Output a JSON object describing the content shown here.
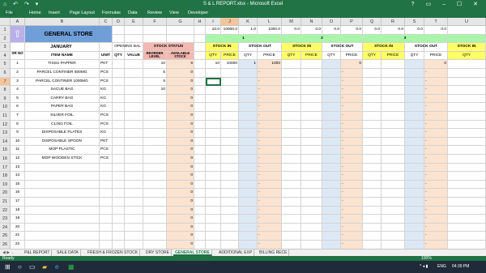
{
  "window": {
    "title": "S & L REPORT.xlsx - Microsoft Excel",
    "quick_access": "⌂ ↶ ↷ ▾",
    "controls": "? ▭ – ☐ ✕"
  },
  "ribbon_tabs": [
    "File",
    "Home",
    "Insert",
    "Page Layout",
    "Formulas",
    "Data",
    "Review",
    "View",
    "Developer"
  ],
  "columns": [
    "A",
    "B",
    "C",
    "D",
    "E",
    "F",
    "G",
    "H",
    "I",
    "J",
    "K",
    "L",
    "M",
    "N",
    "O",
    "P",
    "Q",
    "R",
    "S",
    "T",
    "U"
  ],
  "row_numbers": [
    "1",
    "2",
    "3",
    "4",
    "5",
    "6",
    "7",
    "8",
    "9",
    "10",
    "11",
    "12",
    "13",
    "14",
    "15",
    "16",
    "17",
    "18",
    "19",
    "20",
    "21",
    "22",
    "23",
    "24",
    "25",
    "26"
  ],
  "header": {
    "store_name": "GENERAL STORE",
    "month": "JANUARY",
    "opening_bal": "OPENING BAL",
    "stock_status": "STOCK STATUS",
    "sr_no": "SR NO",
    "item_name": "ITEM NAME",
    "unit": "UNIT",
    "qty": "QTY",
    "value": "VALUE",
    "reorder_level": "REORDER LEVEL",
    "available_stock": "AVAILABLE STOCK",
    "stock_in": "STOCK IN",
    "stock_out": "STOCK OUT",
    "qty_short": "QTY",
    "price": "PRICE"
  },
  "top_values": [
    "10.0",
    "10000.0",
    "1.0",
    "1000.0",
    "0.0",
    "0.0",
    "0.0",
    "0.0",
    "0.0",
    "0.0",
    "0.0",
    "0.0"
  ],
  "days": [
    "1",
    "2",
    "3"
  ],
  "items": [
    {
      "sr": "1",
      "name": "TISSU PAPPER",
      "unit": "PKT",
      "reorder": "10",
      "avail": "9"
    },
    {
      "sr": "2",
      "name": "PARCEL CONTINER 500MG",
      "unit": "PCS",
      "reorder": "5",
      "avail": "0"
    },
    {
      "sr": "3",
      "name": "PARCEL CONTINER 1000MG",
      "unit": "PCS",
      "reorder": "5",
      "avail": "0"
    },
    {
      "sr": "4",
      "name": "SACUE BAG",
      "unit": "KG",
      "reorder": "10",
      "avail": "0"
    },
    {
      "sr": "5",
      "name": "CARRY BAG",
      "unit": "KG",
      "reorder": "",
      "avail": "0"
    },
    {
      "sr": "6",
      "name": "PAPER BAG",
      "unit": "KG",
      "reorder": "",
      "avail": "0"
    },
    {
      "sr": "7",
      "name": "SILVER FOIL",
      "unit": "PCS",
      "reorder": "",
      "avail": "0"
    },
    {
      "sr": "8",
      "name": "CLING FOIL",
      "unit": "PCS",
      "reorder": "",
      "avail": "0"
    },
    {
      "sr": "9",
      "name": "DISPOSABLE PLATES",
      "unit": "KG",
      "reorder": "",
      "avail": "0"
    },
    {
      "sr": "10",
      "name": "DISPOSABLE SPOON",
      "unit": "PKT",
      "reorder": "",
      "avail": "0"
    },
    {
      "sr": "11",
      "name": "MOP PLASTIC",
      "unit": "PCS",
      "reorder": "",
      "avail": "0"
    },
    {
      "sr": "12",
      "name": "MOP WOODEN STICK",
      "unit": "PCS",
      "reorder": "",
      "avail": "0"
    },
    {
      "sr": "13",
      "name": "",
      "unit": "",
      "reorder": "",
      "avail": "0"
    },
    {
      "sr": "14",
      "name": "",
      "unit": "",
      "reorder": "",
      "avail": "0"
    },
    {
      "sr": "15",
      "name": "",
      "unit": "",
      "reorder": "",
      "avail": "0"
    },
    {
      "sr": "16",
      "name": "",
      "unit": "",
      "reorder": "",
      "avail": "0"
    },
    {
      "sr": "17",
      "name": "",
      "unit": "",
      "reorder": "",
      "avail": "0"
    },
    {
      "sr": "18",
      "name": "",
      "unit": "",
      "reorder": "",
      "avail": "0"
    },
    {
      "sr": "19",
      "name": "",
      "unit": "",
      "reorder": "",
      "avail": "0"
    },
    {
      "sr": "20",
      "name": "",
      "unit": "",
      "reorder": "",
      "avail": "0"
    },
    {
      "sr": "21",
      "name": "",
      "unit": "",
      "reorder": "",
      "avail": "0"
    },
    {
      "sr": "22",
      "name": "",
      "unit": "",
      "reorder": "",
      "avail": "0"
    }
  ],
  "row5_entries": {
    "in_qty": "10",
    "in_price": "10000",
    "out_qty": "1",
    "out_price": "1000",
    "day2_out": "0",
    "day3_out": "0"
  },
  "dash": "-",
  "sheet_tabs": [
    "P&L REPORT",
    "SALE DATA",
    "FRESH & FROZEN STOCK",
    "DRY STORE",
    "GENERAL STORE",
    "ADDITIONAL EXP",
    "BILLING RECE"
  ],
  "active_sheet": "GENERAL STORE",
  "status": {
    "ready": "Ready",
    "zoom": "100%"
  },
  "taskbar": {
    "lang": "ENG",
    "time": "04:39 PM"
  },
  "colors": {
    "excel_green": "#217346",
    "title_blue": "#6f9ed8",
    "header_pink": "#f4b8b0",
    "stock_in_yellow": "#ffff66",
    "day_green": "#a9f5a9",
    "col_blue": "#dde8f5",
    "col_peach": "#fbe3d0"
  }
}
